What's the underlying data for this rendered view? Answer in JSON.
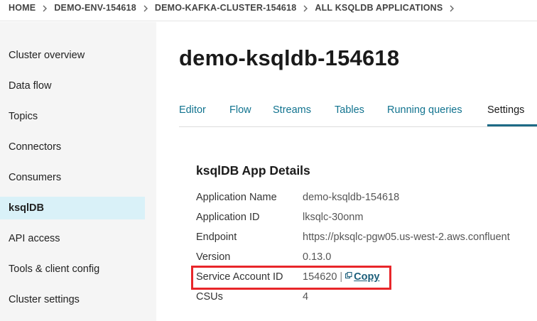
{
  "breadcrumb": {
    "items": [
      {
        "label": "HOME"
      },
      {
        "label": "DEMO-ENV-154618"
      },
      {
        "label": "DEMO-KAFKA-CLUSTER-154618"
      },
      {
        "label": "ALL KSQLDB APPLICATIONS"
      }
    ]
  },
  "sidebar": {
    "items": [
      {
        "label": "Cluster overview"
      },
      {
        "label": "Data flow"
      },
      {
        "label": "Topics"
      },
      {
        "label": "Connectors"
      },
      {
        "label": "Consumers"
      },
      {
        "label": "ksqlDB",
        "active": true
      },
      {
        "label": "API access"
      },
      {
        "label": "Tools & client config"
      },
      {
        "label": "Cluster settings"
      }
    ]
  },
  "main": {
    "title": "demo-ksqldb-154618",
    "tabs": [
      {
        "label": "Editor"
      },
      {
        "label": "Flow"
      },
      {
        "label": "Streams"
      },
      {
        "label": "Tables"
      },
      {
        "label": "Running queries"
      },
      {
        "label": "Settings",
        "active": true
      }
    ],
    "details": {
      "title": "ksqlDB App Details",
      "rows": [
        {
          "label": "Application Name",
          "value": "demo-ksqldb-154618"
        },
        {
          "label": "Application ID",
          "value": "lksqlc-30onm"
        },
        {
          "label": "Endpoint",
          "value": "https://pksqlc-pgw05.us-west-2.aws.confluent"
        },
        {
          "label": "Version",
          "value": "0.13.0"
        },
        {
          "label": "Service Account ID",
          "value": "154620",
          "separator": "|",
          "copy_label": "Copy"
        },
        {
          "label": "CSUs",
          "value": "4"
        }
      ]
    }
  },
  "colors": {
    "accent": "#11738f",
    "active_sidebar_bg": "#d9f1f8",
    "highlight": "#e8262a"
  },
  "icons": {
    "breadcrumb_separator": "chevron-right-icon",
    "copy": "copy-icon"
  }
}
